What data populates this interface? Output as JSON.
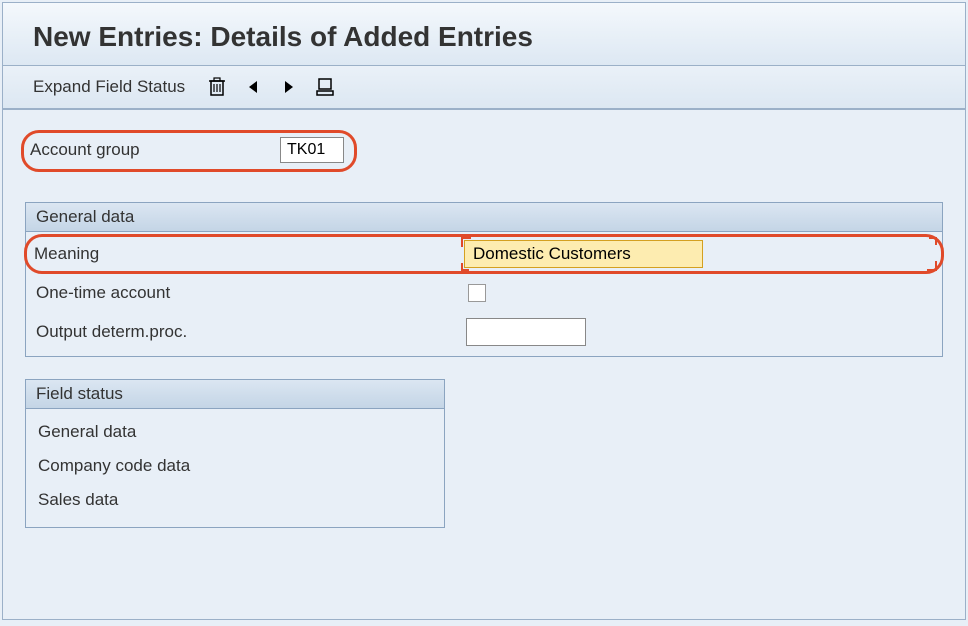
{
  "title": "New Entries: Details of Added Entries",
  "toolbar": {
    "expand_label": "Expand Field Status"
  },
  "account_group": {
    "label": "Account group",
    "value": "TK01"
  },
  "general_data": {
    "header": "General data",
    "meaning_label": "Meaning",
    "meaning_value": "Domestic Customers",
    "onetime_label": "One-time account",
    "output_label": "Output determ.proc.",
    "output_value": ""
  },
  "field_status": {
    "header": "Field status",
    "items": [
      "General data",
      "Company code data",
      "Sales data"
    ]
  }
}
